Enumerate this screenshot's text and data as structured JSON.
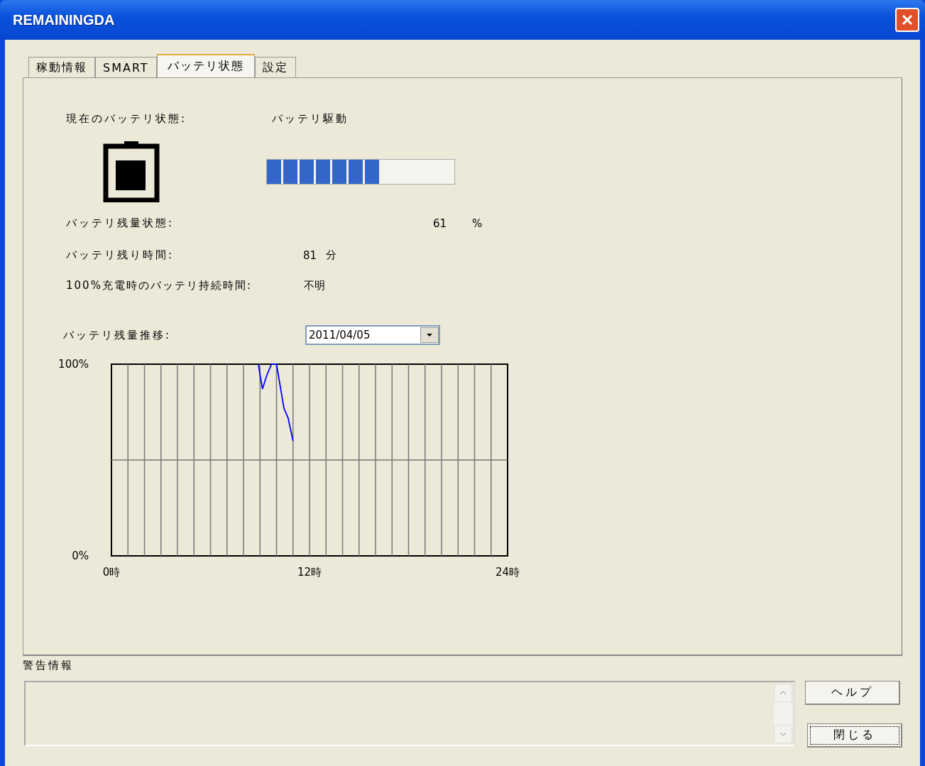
{
  "window": {
    "title": "REMAININGDA"
  },
  "tabs": [
    {
      "label": "稼動情報",
      "selected": false
    },
    {
      "label": "SMART",
      "selected": false
    },
    {
      "label": "バッテリ状態",
      "selected": true
    },
    {
      "label": "設定",
      "selected": false
    }
  ],
  "status": {
    "label": "現在のバッテリ状態:",
    "value": "バッテリ駆動"
  },
  "charge": {
    "level": 0.61
  },
  "remaining": {
    "label": "バッテリ残量状態:",
    "value": "61",
    "unit": "%"
  },
  "time_left": {
    "label": "バッテリ残り時間:",
    "value": "81",
    "unit": "分"
  },
  "full_duration": {
    "label": "100%充電時のバッテリ持続時間:",
    "value": "不明"
  },
  "history": {
    "label": "バッテリ残量推移:",
    "date": "2011/04/05",
    "chart_data": {
      "type": "line",
      "x": [
        8.9,
        9.15,
        9.4,
        9.7,
        10.0,
        10.45,
        10.7,
        11.0
      ],
      "series": [
        {
          "color": "#0000ff",
          "values": [
            100,
            87,
            94,
            100,
            100,
            77,
            72,
            60
          ]
        }
      ],
      "xlim": [
        0,
        24
      ],
      "ylim": [
        0,
        100
      ],
      "xticks": [
        {
          "value": 0,
          "label": "0時"
        },
        {
          "value": 12,
          "label": "12時"
        },
        {
          "value": 24,
          "label": "24時"
        }
      ],
      "yticks": [
        {
          "value": 0,
          "label": "0%"
        },
        {
          "value": 100,
          "label": "100%"
        }
      ]
    }
  },
  "warnings": {
    "label": "警告情報"
  },
  "buttons": [
    "ヘルプ",
    "閉じる"
  ]
}
